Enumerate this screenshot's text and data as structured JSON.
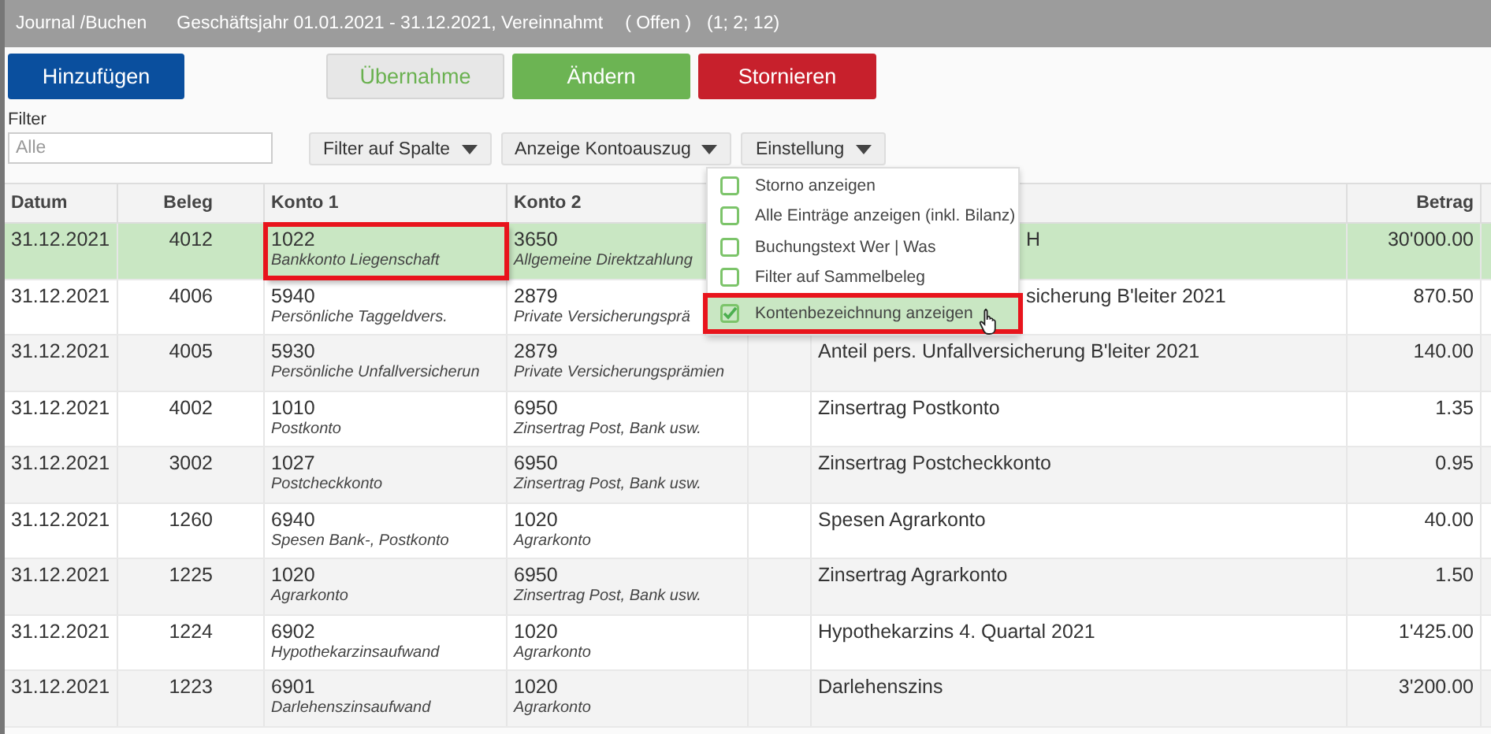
{
  "title_bar": {
    "module": "Journal /Buchen",
    "fiscal_year": "Geschäftsjahr 01.01.2021 - 31.12.2021, Vereinnahmt",
    "status": "( Offen )",
    "ids": "(1; 2; 12)"
  },
  "buttons": [
    {
      "label": "Hinzufügen",
      "kind": "primary"
    },
    {
      "label": "Übernahme",
      "kind": "disabled"
    },
    {
      "label": "Ändern",
      "kind": "success"
    },
    {
      "label": "Stornieren",
      "kind": "danger"
    }
  ],
  "filter": {
    "label": "Filter",
    "placeholder": "Alle"
  },
  "dropdowns": [
    {
      "label": "Filter auf Spalte"
    },
    {
      "label": "Anzeige Kontoauszug"
    },
    {
      "label": "Einstellung"
    }
  ],
  "settings_menu": [
    {
      "label": "Storno anzeigen",
      "checked": false,
      "highlighted": false
    },
    {
      "label": "Alle Einträge anzeigen (inkl. Bilanz)",
      "checked": false,
      "highlighted": false
    },
    {
      "label": "Buchungstext Wer | Was",
      "checked": false,
      "highlighted": false
    },
    {
      "label": "Filter auf Sammelbeleg",
      "checked": false,
      "highlighted": false
    },
    {
      "label": "Kontenbezeichnung anzeigen",
      "checked": true,
      "highlighted": true
    }
  ],
  "table": {
    "columns": [
      "Datum",
      "Beleg",
      "Konto 1",
      "Konto 2",
      "",
      "",
      "Betrag"
    ],
    "rows": [
      {
        "date": "31.12.2021",
        "beleg": "4012",
        "konto1": {
          "number": "1022",
          "name": "Bankkonto Liegenschaft",
          "highlighted": true
        },
        "konto2": {
          "number": "3650",
          "name": "Allgemeine Direktzahlung"
        },
        "text": "H",
        "covered": true,
        "amount": "30'000.00",
        "selected": true
      },
      {
        "date": "31.12.2021",
        "beleg": "4006",
        "konto1": {
          "number": "5940",
          "name": "Persönliche Taggeldvers.",
          "highlighted": false
        },
        "konto2": {
          "number": "2879",
          "name": "Private Versicherungsprä"
        },
        "text": "sicherung B'leiter 2021",
        "covered": true,
        "amount": "870.50",
        "selected": false
      },
      {
        "date": "31.12.2021",
        "beleg": "4005",
        "konto1": {
          "number": "5930",
          "name": "Persönliche Unfallversicherun",
          "highlighted": false
        },
        "konto2": {
          "number": "2879",
          "name": "Private Versicherungsprämien"
        },
        "text": "Anteil pers. Unfallversicherung B'leiter 2021",
        "covered": false,
        "amount": "140.00",
        "selected": false
      },
      {
        "date": "31.12.2021",
        "beleg": "4002",
        "konto1": {
          "number": "1010",
          "name": "Postkonto",
          "highlighted": false
        },
        "konto2": {
          "number": "6950",
          "name": "Zinsertrag Post, Bank usw."
        },
        "text": "Zinsertrag Postkonto",
        "covered": false,
        "amount": "1.35",
        "selected": false
      },
      {
        "date": "31.12.2021",
        "beleg": "3002",
        "konto1": {
          "number": "1027",
          "name": "Postcheckkonto",
          "highlighted": false
        },
        "konto2": {
          "number": "6950",
          "name": "Zinsertrag Post, Bank usw."
        },
        "text": "Zinsertrag Postcheckkonto",
        "covered": false,
        "amount": "0.95",
        "selected": false
      },
      {
        "date": "31.12.2021",
        "beleg": "1260",
        "konto1": {
          "number": "6940",
          "name": "Spesen Bank-, Postkonto",
          "highlighted": false
        },
        "konto2": {
          "number": "1020",
          "name": "Agrarkonto"
        },
        "text": "Spesen Agrarkonto",
        "covered": false,
        "amount": "40.00",
        "selected": false
      },
      {
        "date": "31.12.2021",
        "beleg": "1225",
        "konto1": {
          "number": "1020",
          "name": "Agrarkonto",
          "highlighted": false
        },
        "konto2": {
          "number": "6950",
          "name": "Zinsertrag Post, Bank usw."
        },
        "text": "Zinsertrag Agrarkonto",
        "covered": false,
        "amount": "1.50",
        "selected": false
      },
      {
        "date": "31.12.2021",
        "beleg": "1224",
        "konto1": {
          "number": "6902",
          "name": "Hypothekarzinsaufwand",
          "highlighted": false
        },
        "konto2": {
          "number": "1020",
          "name": "Agrarkonto"
        },
        "text": "Hypothekarzins 4. Quartal 2021",
        "covered": false,
        "amount": "1'425.00",
        "selected": false
      },
      {
        "date": "31.12.2021",
        "beleg": "1223",
        "konto1": {
          "number": "6901",
          "name": "Darlehenszinsaufwand",
          "highlighted": false
        },
        "konto2": {
          "number": "1020",
          "name": "Agrarkonto"
        },
        "text": "Darlehenszins",
        "covered": false,
        "amount": "3'200.00",
        "selected": false
      }
    ]
  }
}
